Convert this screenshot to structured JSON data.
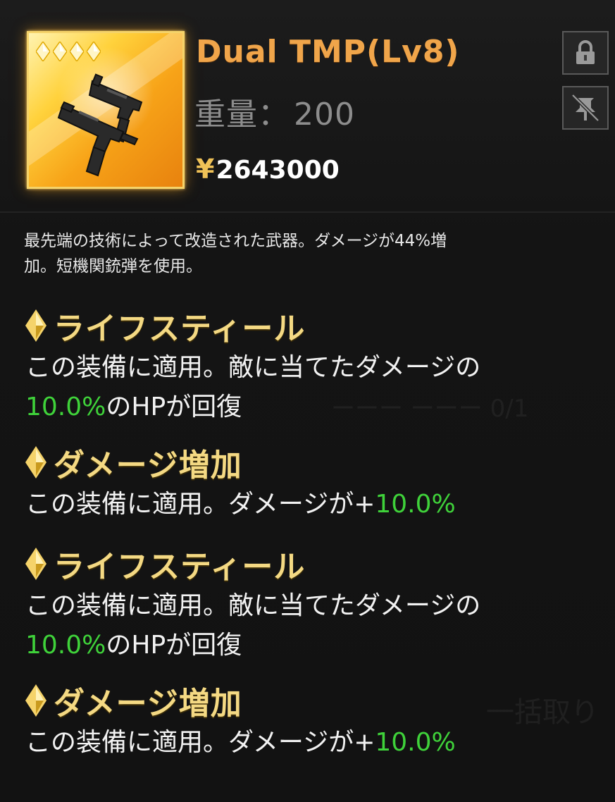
{
  "item": {
    "name": "Dual TMP(Lv8)",
    "weight_label": "重量：",
    "weight_value": "200",
    "currency_symbol": "¥",
    "price": "2643000",
    "icon": "submachine-gun-icon",
    "rarity_stars": 4
  },
  "buttons": {
    "lock_icon": "lock-icon",
    "unpin_icon": "unpin-icon"
  },
  "description_line1": "最先端の技術によって改造された武器。ダメージが44%増",
  "description_line2": "加。短機関銃弾を使用。",
  "effects": [
    {
      "name": "ライフスティール",
      "line1": "この装備に適用。敵に当てたダメージの",
      "value": "10.0%",
      "suffix": "のHPが回復"
    },
    {
      "name": "ダメージ増加",
      "prefix": "この装備に適用。ダメージが+",
      "value": "10.0%"
    },
    {
      "name": "ライフスティール",
      "line1": "この装備に適用。敵に当てたダメージの",
      "value": "10.0%",
      "suffix": "のHPが回復"
    },
    {
      "name": "ダメージ増加",
      "prefix": "この装備に適用。ダメージが+",
      "value": "10.0%"
    }
  ],
  "colors": {
    "title": "#f0a54a",
    "effect_name": "#f4d983",
    "value_green": "#3fd23a",
    "frame_gold": "#f5d36a"
  }
}
